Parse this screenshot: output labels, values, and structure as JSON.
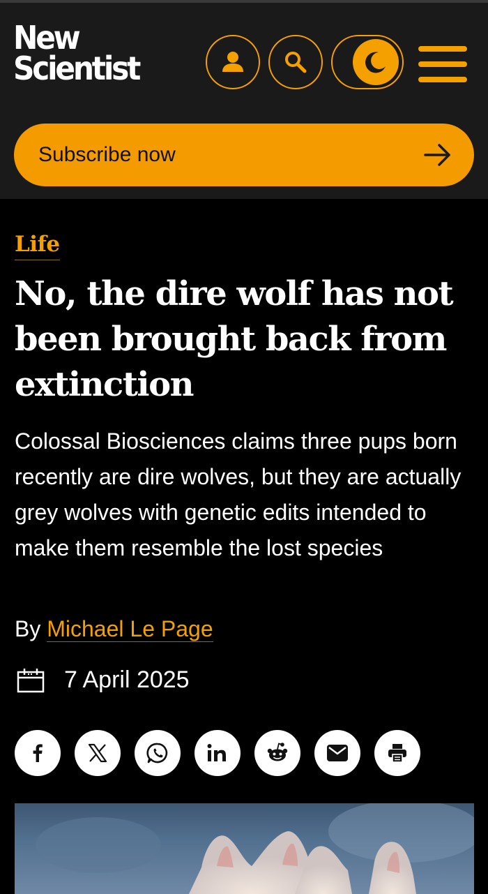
{
  "header": {
    "logo_line1": "New",
    "logo_line2": "Scientist",
    "account_icon": "user-icon",
    "search_icon": "search-icon",
    "theme_icon": "moon-icon",
    "menu_icon": "hamburger-icon"
  },
  "subscribe": {
    "label": "Subscribe now",
    "icon": "arrow-right-icon"
  },
  "article": {
    "section": "Life",
    "headline": "No, the dire wolf has not been brought back from extinction",
    "standfirst": "Colossal Biosciences claims three pups born recently are dire wolves, but they are actually grey wolves with genetic edits intended to make them resemble the lost species",
    "byline_prefix": "By",
    "author": "Michael Le Page",
    "date": "7 April 2025"
  },
  "share": {
    "icons": [
      "facebook-icon",
      "x-icon",
      "whatsapp-icon",
      "linkedin-icon",
      "reddit-icon",
      "email-icon",
      "print-icon"
    ]
  },
  "colors": {
    "accent": "#f4a100",
    "header_bg": "#1a1a1a",
    "page_bg": "#000000",
    "text": "#ffffff"
  }
}
